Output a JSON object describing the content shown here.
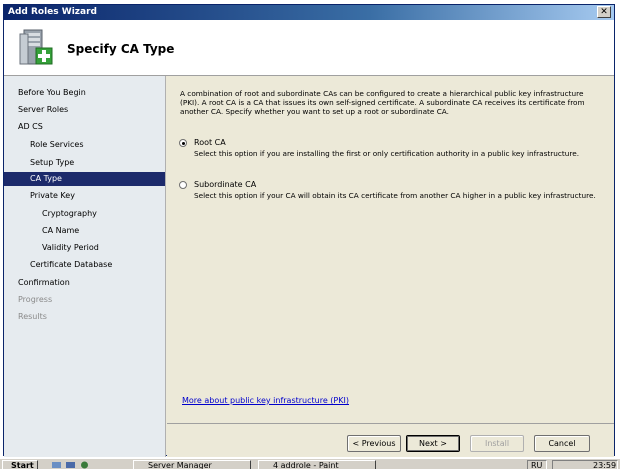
{
  "window": {
    "title": "Add Roles Wizard",
    "close_symbol": "✕"
  },
  "header": {
    "title": "Specify CA Type",
    "icon": "server-install-icon"
  },
  "sidebar": {
    "items": [
      {
        "label": "Before You Begin",
        "state": "normal"
      },
      {
        "label": "Server Roles",
        "state": "normal"
      },
      {
        "label": "AD CS",
        "state": "normal"
      },
      {
        "label": "Role Services",
        "state": "normal"
      },
      {
        "label": "Setup Type",
        "state": "normal"
      },
      {
        "label": "CA Type",
        "state": "selected"
      },
      {
        "label": "Private Key",
        "state": "normal"
      },
      {
        "label": "Cryptography",
        "state": "normal"
      },
      {
        "label": "CA Name",
        "state": "normal"
      },
      {
        "label": "Validity Period",
        "state": "normal"
      },
      {
        "label": "Certificate Database",
        "state": "normal"
      },
      {
        "label": "Confirmation",
        "state": "normal"
      },
      {
        "label": "Progress",
        "state": "disabled"
      },
      {
        "label": "Results",
        "state": "disabled"
      }
    ]
  },
  "main": {
    "description": "A combination of root and subordinate CAs can be configured to create a hierarchical public key infrastructure (PKI). A root CA is a CA that issues its own self-signed certificate. A subordinate CA receives its certificate from another CA. Specify whether you want to set up a root or subordinate CA.",
    "options": [
      {
        "label": "Root CA",
        "selected": true,
        "description": "Select this option if you are installing the first or only certification authority in a public key infrastructure."
      },
      {
        "label": "Subordinate CA",
        "selected": false,
        "description": "Select this option if your CA will obtain its CA certificate from another CA higher in a public key infrastructure."
      }
    ],
    "link": "More about public key infrastructure (PKI)"
  },
  "footer": {
    "previous": "< Previous",
    "next": "Next >",
    "install": "Install",
    "cancel": "Cancel"
  },
  "taskbar": {
    "start": "Start",
    "tasks": [
      "Server Manager",
      "4 addrole - Paint"
    ],
    "language": "RU",
    "clock": "23:59"
  },
  "colors": {
    "selected_nav": "#1c2a6b",
    "sidebar_bg": "#e6ebef",
    "content_bg": "#ece9d8",
    "link": "#0000cc"
  }
}
